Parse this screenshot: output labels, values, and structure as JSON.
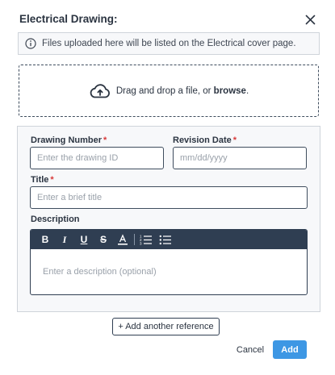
{
  "dialog": {
    "title": "Electrical Drawing:"
  },
  "info": {
    "text": "Files uploaded here will be listed on the Electrical cover page."
  },
  "dropzone": {
    "text": "Drag and drop a file, or ",
    "browse_label": "browse",
    "suffix": "."
  },
  "form": {
    "drawing_number": {
      "label": "Drawing Number",
      "required_mark": "*",
      "placeholder": "Enter the drawing ID",
      "value": ""
    },
    "revision_date": {
      "label": "Revision Date",
      "required_mark": "*",
      "placeholder": "mm/dd/yyyy",
      "value": ""
    },
    "title": {
      "label": "Title",
      "required_mark": "*",
      "placeholder": "Enter a brief title",
      "value": ""
    },
    "description": {
      "label": "Description",
      "placeholder": "Enter a description (optional)",
      "toolbar": [
        "bold-icon",
        "italic-icon",
        "underline-icon",
        "strikethrough-icon",
        "text-color-icon",
        "ordered-list-icon",
        "bulleted-list-icon"
      ]
    }
  },
  "actions": {
    "add_reference_label": "+ Add another reference",
    "cancel_label": "Cancel",
    "add_label": "Add"
  },
  "colors": {
    "primary": "#3d97e4",
    "toolbar": "#2f3e52",
    "required": "#d83a3a",
    "panel_bg": "#f7f8fa"
  }
}
